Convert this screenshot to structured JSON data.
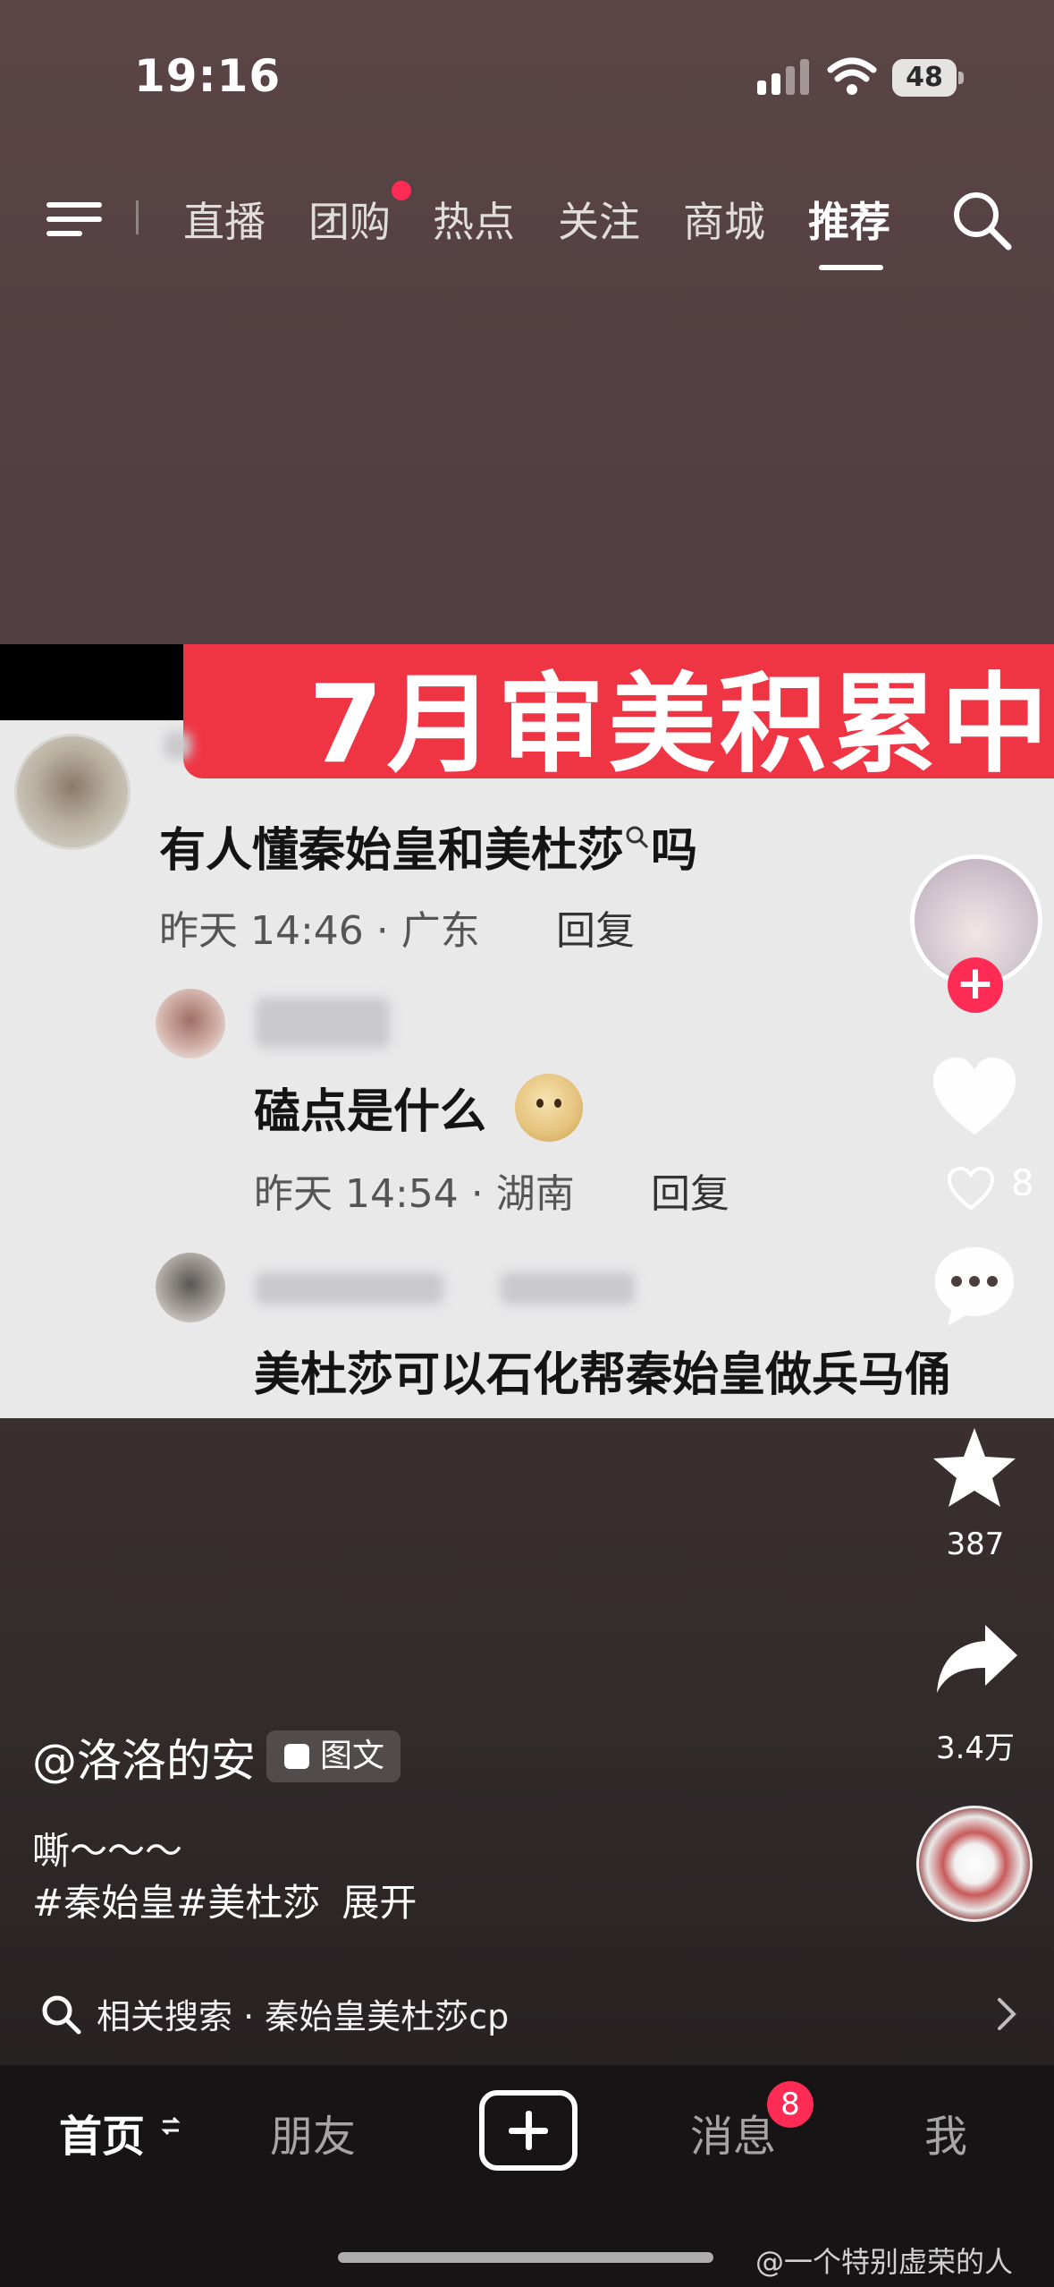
{
  "status_bar": {
    "time": "19:16",
    "battery": "48"
  },
  "top_nav": {
    "tabs": [
      "直播",
      "团购",
      "热点",
      "关注",
      "商城",
      "推荐"
    ],
    "active_tab": "推荐"
  },
  "video": {
    "banner": "7月审美积累中",
    "comments": [
      {
        "text": "有人懂秦始皇和美杜莎",
        "suffix": "吗",
        "meta": "昨天 14:46 · 广东",
        "reply": "回复"
      },
      {
        "text": "磕点是什么",
        "meta": "昨天 14:54 · 湖南",
        "reply": "回复"
      },
      {
        "text": "美杜莎可以石化帮秦始皇做兵马俑"
      }
    ]
  },
  "actions": {
    "like_count": "8",
    "favorite_count": "387",
    "share_count": "3.4万"
  },
  "post": {
    "author": "@洛洛的安",
    "badge": "图文",
    "description": "嘶～～～",
    "hashtags": [
      "#秦始皇#美杜莎",
      "展开"
    ]
  },
  "related_search": {
    "label": "相关搜索 · 秦始皇美杜莎cp"
  },
  "tabbar": {
    "items": [
      "首页",
      "朋友",
      "消息",
      "我"
    ],
    "message_badge": "8"
  },
  "watermark": "@一个特别虚荣的人"
}
